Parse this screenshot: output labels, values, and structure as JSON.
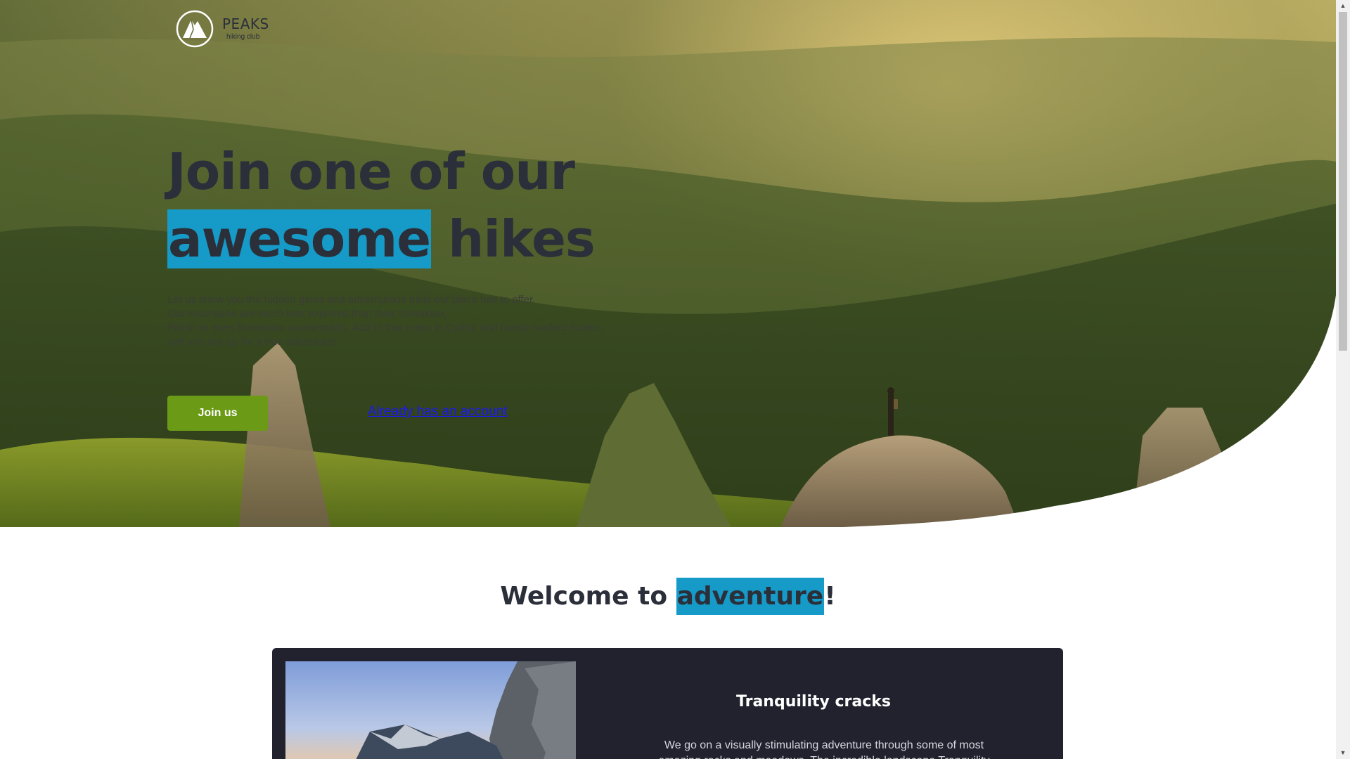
{
  "brand": {
    "name": "PEAKS",
    "tagline": "hiking club",
    "logo_icon": "mountain-logo-icon"
  },
  "hero": {
    "headline_line1": "Join one of our",
    "headline_highlight": "awesome",
    "headline_rest": " hikes",
    "intro_lines": [
      "Let us show you the hidden gems and adventurous trails our place has to offer.",
      "Our mountains are much less explored than their Slovakian,",
      "Polish or even Romanian counterparts. Add to that maps in Cyrillic and barely marked routes,",
      "and you are up for a true adventure!"
    ],
    "join_button": "Join us",
    "account_link": "Already has an account"
  },
  "welcome": {
    "prefix": "Welcome to ",
    "highlight": "adventure",
    "suffix": "!"
  },
  "card": {
    "title": "Tranquility cracks",
    "text": "We go on a visually stimulating adventure through some of most amazing rocks and meadows. The incredible landscape Tranquility"
  },
  "colors": {
    "highlight": "#169ac7",
    "primary_button": "#6a9a16",
    "text_dark": "#2b2f3a",
    "card_bg": "#21222e"
  }
}
